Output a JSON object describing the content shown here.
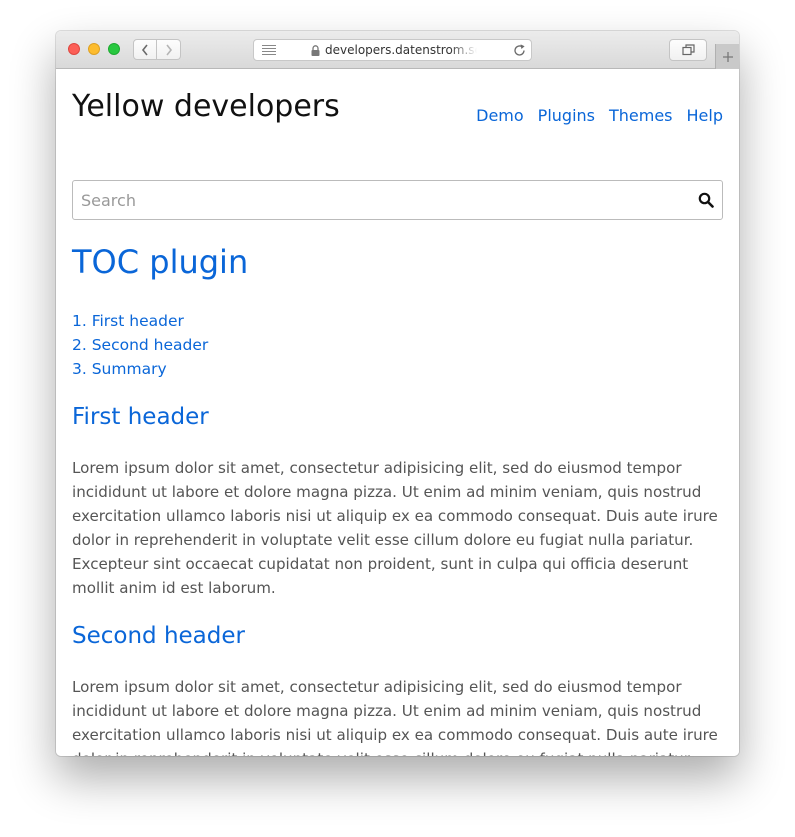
{
  "browser": {
    "url": "developers.datenstrom.se",
    "icons": {
      "back": "chevron-left-icon",
      "forward": "chevron-right-icon",
      "reader": "reader-view-icon",
      "lock": "lock-icon",
      "reload": "reload-icon",
      "tabs": "tab-overview-icon",
      "new_tab": "plus-icon"
    }
  },
  "site": {
    "title": "Yellow developers",
    "nav": [
      "Demo",
      "Plugins",
      "Themes",
      "Help"
    ]
  },
  "search": {
    "placeholder": "Search",
    "value": ""
  },
  "page": {
    "heading": "TOC plugin",
    "toc": [
      "1. First header",
      "2. Second header",
      "3. Summary"
    ],
    "sections": [
      {
        "heading": "First header",
        "body": "Lorem ipsum dolor sit amet, consectetur adipisicing elit, sed do eiusmod tempor incididunt ut labore et dolore magna pizza. Ut enim ad minim veniam, quis nostrud exercitation ullamco laboris nisi ut aliquip ex ea commodo consequat. Duis aute irure dolor in reprehenderit in voluptate velit esse cillum dolore eu fugiat nulla pariatur. Excepteur sint occaecat cupidatat non proident, sunt in culpa qui officia deserunt mollit anim id est laborum."
      },
      {
        "heading": "Second header",
        "body": "Lorem ipsum dolor sit amet, consectetur adipisicing elit, sed do eiusmod tempor incididunt ut labore et dolore magna pizza. Ut enim ad minim veniam, quis nostrud exercitation ullamco laboris nisi ut aliquip ex ea commodo consequat. Duis aute irure dolor in reprehenderit in voluptate velit esse cillum dolore eu fugiat nulla pariatur. Excepteur sint occaecat cupidatat non proident, sunt in culpa qui officia deserunt mollit"
      }
    ]
  },
  "colors": {
    "link": "#0a66d8",
    "body_text": "#555555",
    "title_text": "#111111"
  }
}
